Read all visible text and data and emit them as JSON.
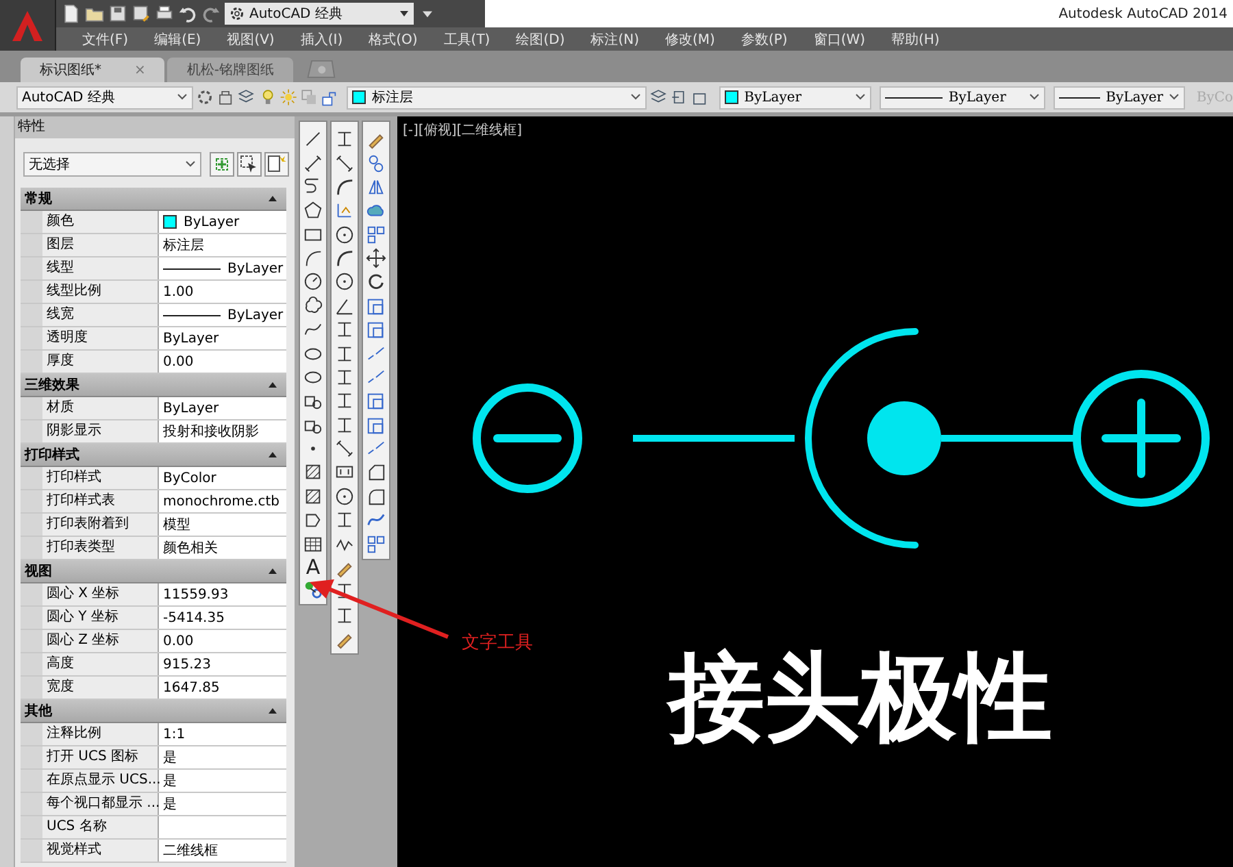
{
  "app_title": "Autodesk AutoCAD 2014",
  "quick_access": {
    "workspace": "AutoCAD 经典"
  },
  "menu": [
    "文件(F)",
    "编辑(E)",
    "视图(V)",
    "插入(I)",
    "格式(O)",
    "工具(T)",
    "绘图(D)",
    "标注(N)",
    "修改(M)",
    "参数(P)",
    "窗口(W)",
    "帮助(H)"
  ],
  "doc_tabs": [
    {
      "label": "标识图纸*",
      "selected": true,
      "close": "×"
    },
    {
      "label": "机松-铭牌图纸",
      "selected": false
    }
  ],
  "toolbar": {
    "workspace": "AutoCAD 经典",
    "layer": "标注层",
    "color_setting": "ByLayer",
    "linetype": "ByLayer",
    "lineweight": "ByLayer",
    "plot_style": "ByCo"
  },
  "properties": {
    "title": "特性",
    "selection": "无选择",
    "sections": [
      {
        "title": "常规",
        "expanded": true,
        "rows": [
          {
            "label": "颜色",
            "value": "ByLayer",
            "kind": "color"
          },
          {
            "label": "图层",
            "value": "标注层",
            "kind": "text"
          },
          {
            "label": "线型",
            "value": "ByLayer",
            "kind": "linetype"
          },
          {
            "label": "线型比例",
            "value": "1.00",
            "kind": "text"
          },
          {
            "label": "线宽",
            "value": "ByLayer",
            "kind": "linetype"
          },
          {
            "label": "透明度",
            "value": "ByLayer",
            "kind": "text"
          },
          {
            "label": "厚度",
            "value": "0.00",
            "kind": "text"
          }
        ]
      },
      {
        "title": "三维效果",
        "expanded": true,
        "rows": [
          {
            "label": "材质",
            "value": "ByLayer",
            "kind": "text"
          },
          {
            "label": "阴影显示",
            "value": "投射和接收阴影",
            "kind": "text"
          }
        ]
      },
      {
        "title": "打印样式",
        "expanded": true,
        "rows": [
          {
            "label": "打印样式",
            "value": "ByColor",
            "kind": "text"
          },
          {
            "label": "打印样式表",
            "value": "monochrome.ctb",
            "kind": "text"
          },
          {
            "label": "打印表附着到",
            "value": "模型",
            "kind": "text"
          },
          {
            "label": "打印表类型",
            "value": "颜色相关",
            "kind": "text"
          }
        ]
      },
      {
        "title": "视图",
        "expanded": true,
        "rows": [
          {
            "label": "圆心 X 坐标",
            "value": "11559.93",
            "kind": "text"
          },
          {
            "label": "圆心 Y 坐标",
            "value": "-5414.35",
            "kind": "text"
          },
          {
            "label": "圆心 Z 坐标",
            "value": "0.00",
            "kind": "text"
          },
          {
            "label": "高度",
            "value": "915.23",
            "kind": "text"
          },
          {
            "label": "宽度",
            "value": "1647.85",
            "kind": "text"
          }
        ]
      },
      {
        "title": "其他",
        "expanded": true,
        "rows": [
          {
            "label": "注释比例",
            "value": "1:1",
            "kind": "text"
          },
          {
            "label": "打开 UCS 图标",
            "value": "是",
            "kind": "text"
          },
          {
            "label": "在原点显示 UCS...",
            "value": "是",
            "kind": "text"
          },
          {
            "label": "每个视口都显示 ...",
            "value": "是",
            "kind": "text"
          },
          {
            "label": "UCS 名称",
            "kind": "text"
          },
          {
            "label": "视觉样式",
            "value": "二维线框",
            "kind": "text"
          }
        ]
      }
    ]
  },
  "toolbars": {
    "text_tool": "A"
  },
  "viewport": {
    "label": "[-][俯视][二维线框]",
    "caption": "接头极性"
  },
  "annotation": {
    "text": "文字工具"
  }
}
